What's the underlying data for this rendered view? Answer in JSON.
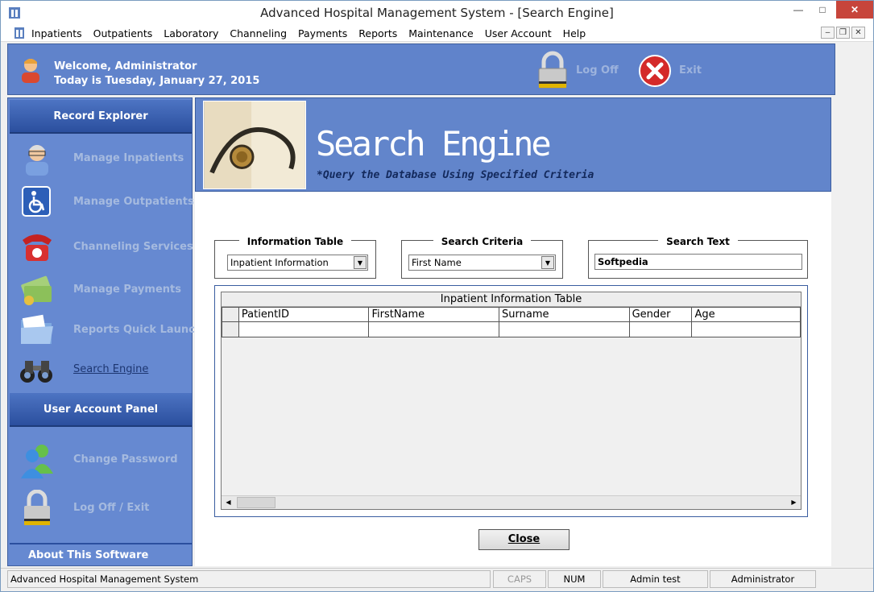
{
  "window": {
    "title": "Advanced Hospital Management System - [Search Engine]"
  },
  "menu": [
    "Inpatients",
    "Outpatients",
    "Laboratory",
    "Channeling",
    "Payments",
    "Reports",
    "Maintenance",
    "User Account",
    "Help"
  ],
  "header": {
    "welcome": "Welcome, Administrator",
    "date": "Today is Tuesday, January 27, 2015",
    "logoff_label": "Log Off",
    "exit_label": "Exit"
  },
  "sidebar": {
    "record_explorer": "Record Explorer",
    "items": [
      {
        "label": "Manage Inpatients",
        "icon": "nurse-icon"
      },
      {
        "label": "Manage Outpatients",
        "icon": "wheelchair-icon"
      },
      {
        "label": "Channeling Services",
        "icon": "telephone-icon"
      },
      {
        "label": "Manage Payments",
        "icon": "money-icon"
      },
      {
        "label": "Reports Quick Launch",
        "icon": "folder-icon"
      },
      {
        "label": "Search Engine",
        "icon": "binoculars-icon"
      }
    ],
    "user_panel": "User Account Panel",
    "user_items": [
      {
        "label": "Change Password",
        "icon": "users-icon"
      },
      {
        "label": "Log Off / Exit",
        "icon": "padlock-icon"
      }
    ],
    "about": "About This Software"
  },
  "banner": {
    "title": "Search Engine",
    "subtitle": "*Query the Database Using Specified Criteria"
  },
  "filters": {
    "info_table_label": "Information Table",
    "info_table_value": "Inpatient Information",
    "criteria_label": "Search Criteria",
    "criteria_value": "First Name",
    "search_text_label": "Search Text",
    "search_text_value": "Softpedia"
  },
  "grid": {
    "caption": "Inpatient Information Table",
    "columns": [
      "PatientID",
      "FirstName",
      "Surname",
      "Gender",
      "Age"
    ]
  },
  "close_label": "Close",
  "status": {
    "app": "Advanced Hospital Management System",
    "caps": "CAPS",
    "num": "NUM",
    "user": "Admin test",
    "role": "Administrator"
  },
  "colors": {
    "accent": "#6285cb",
    "dark_blue": "#2b4f9e",
    "close_red": "#c7453b"
  }
}
